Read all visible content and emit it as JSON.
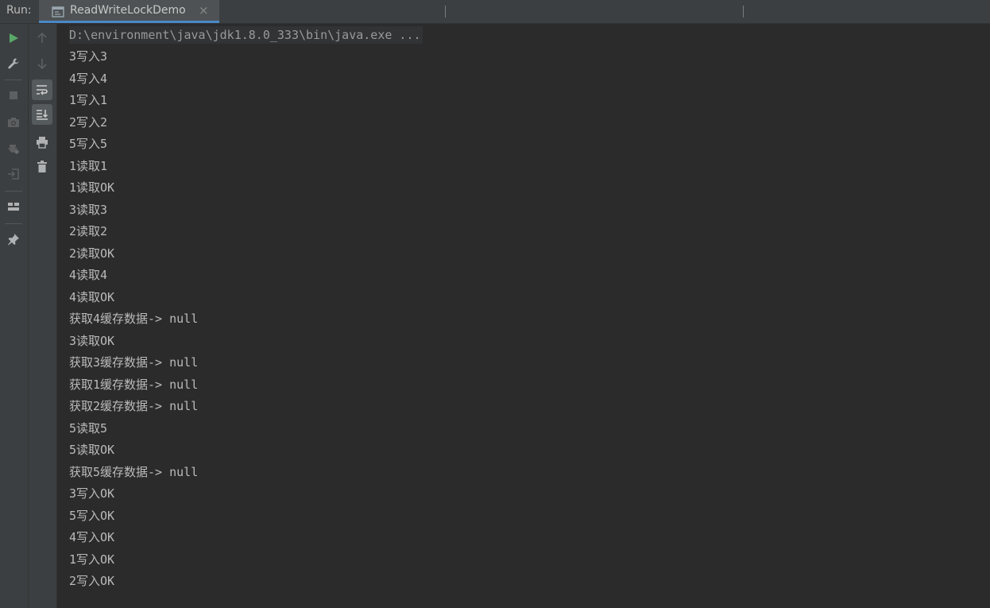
{
  "run_panel": {
    "label": "Run:",
    "tab": {
      "title": "ReadWriteLockDemo",
      "close": "×"
    }
  },
  "toolbar": {
    "left": [
      "run-icon",
      "wrench-icon",
      "stop-icon",
      "camera-icon",
      "debug-settings-icon",
      "login-icon",
      "layout-icon",
      "pin-icon"
    ],
    "right": [
      "arrow-up-icon",
      "arrow-down-icon",
      "soft-wrap-icon",
      "scroll-to-end-icon",
      "print-icon",
      "trash-icon"
    ]
  },
  "console": {
    "command": "D:\\environment\\java\\jdk1.8.0_333\\bin\\java.exe ...",
    "lines": [
      "3写入3",
      "4写入4",
      "1写入1",
      "2写入2",
      "5写入5",
      "1读取1",
      "1读取OK",
      "3读取3",
      "2读取2",
      "2读取OK",
      "4读取4",
      "4读取OK",
      "获取4缓存数据-> null",
      "3读取OK",
      "获取3缓存数据-> null",
      "获取1缓存数据-> null",
      "获取2缓存数据-> null",
      "5读取5",
      "5读取OK",
      "获取5缓存数据-> null",
      "3写入OK",
      "5写入OK",
      "4写入OK",
      "1写入OK",
      "2写入OK"
    ]
  },
  "colors": {
    "background": "#2b2b2b",
    "toolbar": "#3c3f41",
    "text": "#bbbbbb",
    "run_green": "#59a869",
    "tab_accent": "#4a88c7"
  }
}
